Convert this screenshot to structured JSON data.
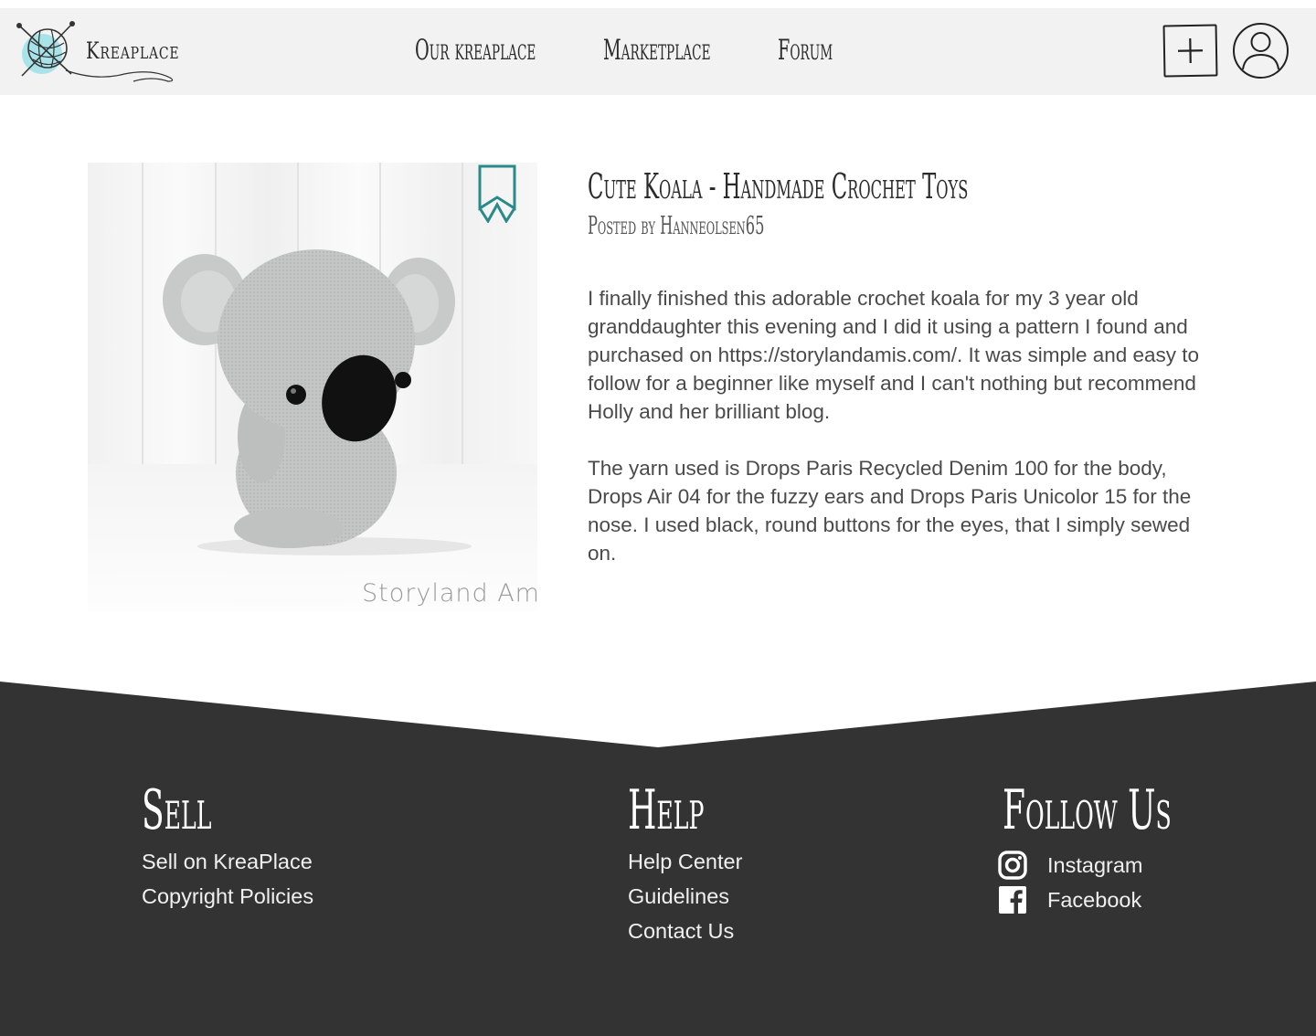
{
  "brand": {
    "name": "Kreaplace"
  },
  "nav": {
    "items": [
      {
        "label": "Our kreaplace"
      },
      {
        "label": "Marketplace"
      },
      {
        "label": "Forum"
      }
    ]
  },
  "header": {
    "add_icon": "plus-icon",
    "user_icon": "user-icon"
  },
  "post": {
    "image_watermark": "Storyland Amis",
    "title": "Cute Koala - Handmade Crochet Toys",
    "author_line": "Posted by Hanneolsen65",
    "paragraphs": [
      "I finally finished this adorable crochet koala for my 3 year old granddaughter this evening and I did it using a pattern I found and purchased on https://storylandamis.com/. It was simple and easy to follow for a beginner like myself and I can't nothing but recommend Holly and her brilliant blog.",
      "The yarn used is Drops Paris Recycled Denim 100 for the body, Drops Air 04 for the fuzzy ears and Drops Paris Unicolor 15 for the nose. I used black, round buttons for the eyes, that I simply sewed on."
    ],
    "bookmark_color": "#2a8a8a"
  },
  "footer": {
    "background": "#333333",
    "sell": {
      "heading": "Sell",
      "links": [
        "Sell on KreaPlace",
        "Copyright Policies"
      ]
    },
    "help": {
      "heading": "Help",
      "links": [
        "Help Center",
        "Guidelines",
        "Contact Us"
      ]
    },
    "follow": {
      "heading": "Follow Us",
      "links": [
        {
          "label": "Instagram",
          "icon": "instagram-icon"
        },
        {
          "label": "Facebook",
          "icon": "facebook-icon"
        }
      ]
    }
  },
  "colors": {
    "header_bg": "#f2f2f2",
    "logo_accent": "#6fd0dc",
    "text_dark": "#2b2b2b"
  }
}
